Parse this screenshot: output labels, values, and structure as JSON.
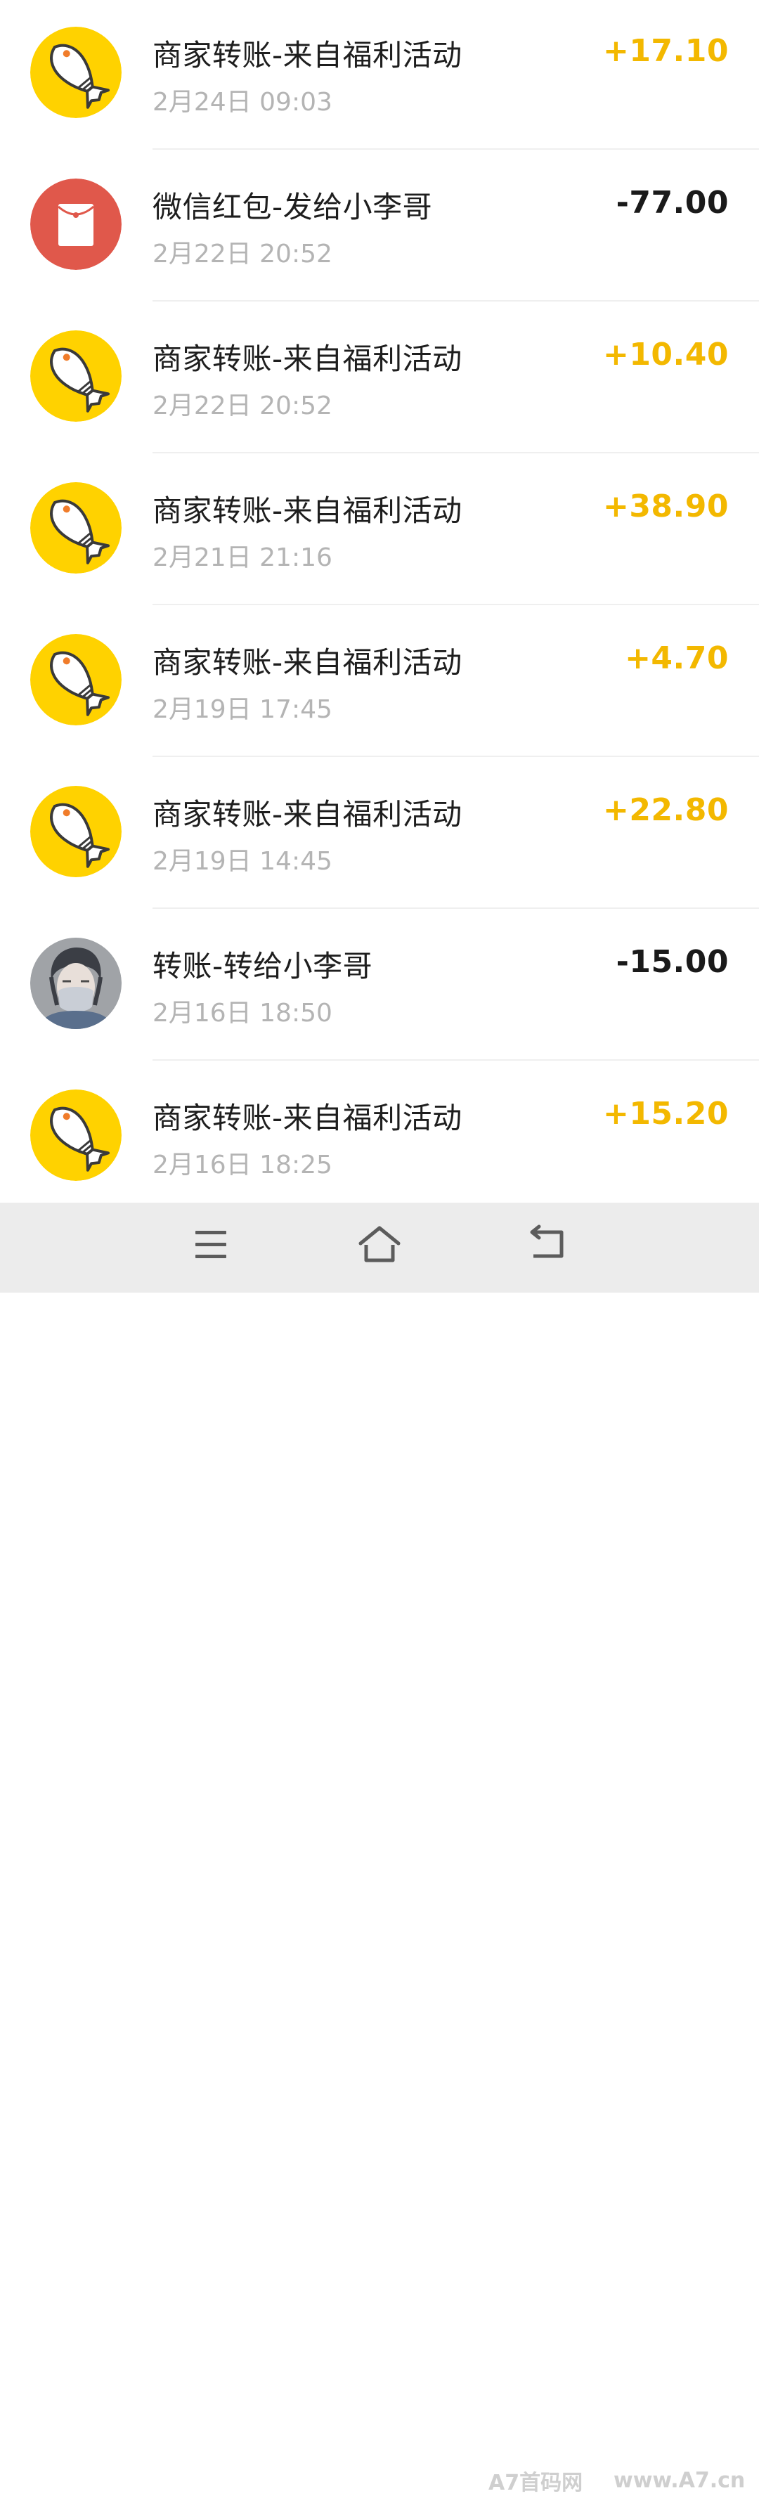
{
  "transactions": [
    {
      "title": "商家转账-来自福利活动",
      "time": "2月24日 09:03",
      "amount": "+17.10",
      "type": "positive",
      "icon": "fish-icon"
    },
    {
      "title": "微信红包-发给小李哥",
      "time": "2月22日 20:52",
      "amount": "-77.00",
      "type": "negative",
      "icon": "red-packet-icon"
    },
    {
      "title": "商家转账-来自福利活动",
      "time": "2月22日 20:52",
      "amount": "+10.40",
      "type": "positive",
      "icon": "fish-icon"
    },
    {
      "title": "商家转账-来自福利活动",
      "time": "2月21日 21:16",
      "amount": "+38.90",
      "type": "positive",
      "icon": "fish-icon"
    },
    {
      "title": "商家转账-来自福利活动",
      "time": "2月19日 17:45",
      "amount": "+4.70",
      "type": "positive",
      "icon": "fish-icon"
    },
    {
      "title": "商家转账-来自福利活动",
      "time": "2月19日 14:45",
      "amount": "+22.80",
      "type": "positive",
      "icon": "fish-icon"
    },
    {
      "title": "转账-转给小李哥",
      "time": "2月16日 18:50",
      "amount": "-15.00",
      "type": "negative",
      "icon": "user-avatar"
    },
    {
      "title": "商家转账-来自福利活动",
      "time": "2月16日 18:25",
      "amount": "+15.20",
      "type": "positive",
      "icon": "fish-icon"
    }
  ],
  "colors": {
    "positive": "#f3b800",
    "negative": "#1a1a1a",
    "fish_bg": "#ffd200",
    "red_packet_bg": "#e0584b",
    "navbar_bg": "#ececec"
  },
  "navbar": {
    "buttons": [
      {
        "name": "menu-button",
        "icon": "menu-icon"
      },
      {
        "name": "home-button",
        "icon": "home-icon"
      },
      {
        "name": "back-button",
        "icon": "back-icon"
      }
    ]
  },
  "watermark": {
    "left": "A7首码网",
    "right": "www.A7.cn"
  }
}
